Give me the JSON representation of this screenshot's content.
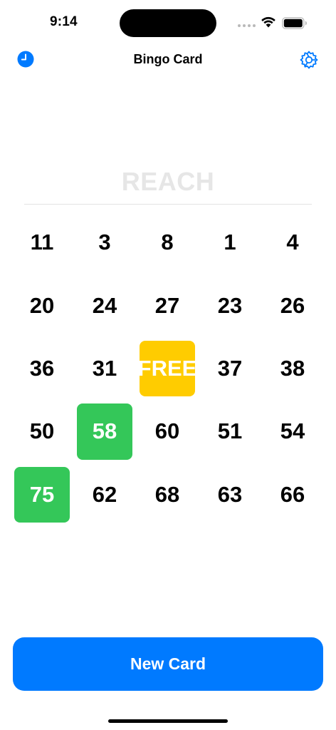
{
  "status_bar": {
    "time": "9:14"
  },
  "nav": {
    "title": "Bingo Card",
    "left_icon": "history-clock-icon",
    "right_icon": "settings-gear-icon"
  },
  "reach_label": "REACH",
  "card": {
    "cells": [
      {
        "label": "11",
        "state": "normal"
      },
      {
        "label": "3",
        "state": "normal"
      },
      {
        "label": "8",
        "state": "normal"
      },
      {
        "label": "1",
        "state": "normal"
      },
      {
        "label": "4",
        "state": "normal"
      },
      {
        "label": "20",
        "state": "normal"
      },
      {
        "label": "24",
        "state": "normal"
      },
      {
        "label": "27",
        "state": "normal"
      },
      {
        "label": "23",
        "state": "normal"
      },
      {
        "label": "26",
        "state": "normal"
      },
      {
        "label": "36",
        "state": "normal"
      },
      {
        "label": "31",
        "state": "normal"
      },
      {
        "label": "FREE",
        "state": "free"
      },
      {
        "label": "37",
        "state": "normal"
      },
      {
        "label": "38",
        "state": "normal"
      },
      {
        "label": "50",
        "state": "normal"
      },
      {
        "label": "58",
        "state": "marked"
      },
      {
        "label": "60",
        "state": "normal"
      },
      {
        "label": "51",
        "state": "normal"
      },
      {
        "label": "54",
        "state": "normal"
      },
      {
        "label": "75",
        "state": "marked"
      },
      {
        "label": "62",
        "state": "normal"
      },
      {
        "label": "68",
        "state": "normal"
      },
      {
        "label": "63",
        "state": "normal"
      },
      {
        "label": "66",
        "state": "normal"
      }
    ]
  },
  "new_card_label": "New Card",
  "colors": {
    "accent": "#007aff",
    "marked": "#34c759",
    "free": "#ffcc00",
    "reach": "#e6e6e6"
  }
}
